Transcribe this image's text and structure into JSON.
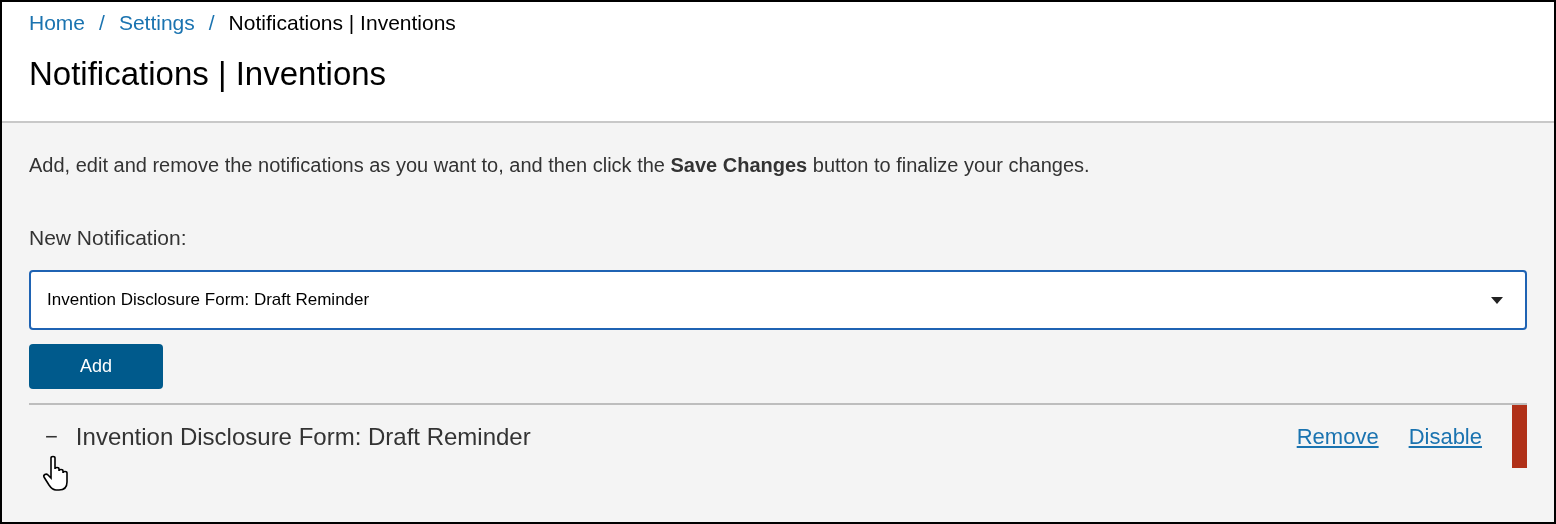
{
  "breadcrumb": [
    {
      "label": "Home",
      "kind": "link"
    },
    {
      "label": "Settings",
      "kind": "link"
    },
    {
      "label": "Notifications | Inventions",
      "kind": "current"
    }
  ],
  "breadcrumb_separator": "/",
  "title": "Notifications | Inventions",
  "instructions": "Add, edit and remove the notifications as you want to, and then click the **Save Changes** button to finalize your changes.",
  "new_notification": {
    "label": "New Notification:",
    "value": "Invention Disclosure Form: Draft Reminder",
    "button": "Add"
  },
  "notifications": [
    {
      "marker": "−",
      "name": "Invention Disclosure Form: Draft Reminder",
      "actions": [
        "Remove",
        "Disable"
      ],
      "color": "#b03018"
    }
  ]
}
